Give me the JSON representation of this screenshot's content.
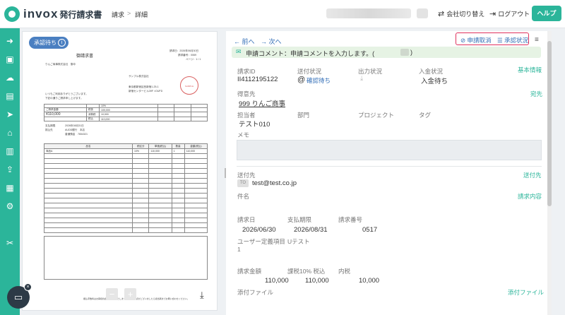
{
  "header": {
    "logo_text": "invox",
    "logo_sub": "発行請求書",
    "crumb_1": "請求",
    "crumb_sep": ">",
    "crumb_2": "詳細",
    "switch_company": "会社切り替え",
    "logout": "ログアウト",
    "help": "ヘルプ"
  },
  "document": {
    "status": "承認待ち",
    "title": "御請求書",
    "recipient": "りんご商事株式会社　御中",
    "issuer": "サンプル株式会社",
    "issuer_addr1": "東京都新宿区西新宿1-25-1",
    "issuer_addr2": "新宿センタービル39F ×OUFD",
    "date_label": "請求日：2026年06月30日",
    "number_label": "請求番号：0069",
    "page_label": "ページ：1 / 1",
    "greeting1": "いつもご利用ありがとうございます。",
    "greeting2": "下記の通りご請求申し上げます。",
    "stamp": "SAMPLE",
    "amount_label": "ご請求金額",
    "amount": "¥110,000",
    "tax_rate": "10%",
    "subtotal": "100,000",
    "tax": "10,000",
    "total": "110,000",
    "row_subtotal": "税抜",
    "row_tax": "消費税",
    "row_total": "税込",
    "due_label": "支払期限",
    "due_value": "2026年08月31日",
    "bank_label": "振込先",
    "bank_value": "AUDD銀行　本店",
    "account_value": "普通預金　7654321",
    "item_headers": [
      "品名",
      "税区分",
      "単価(税込)",
      "数量",
      "金額(税込)"
    ],
    "item_row": [
      "商品A",
      "10%",
      "110,000",
      "1",
      "110,000"
    ],
    "footer": "振込手数料はお客様負担でお願いいたします。ご不明な点がございましたら担当者までお問い合わせください。"
  },
  "detail": {
    "prev": "← 前へ",
    "next": "→ 次へ",
    "cancel_request": "申請取消",
    "approval_status": "承認状況",
    "comment": "申請コメント：申請コメントを入力します。(",
    "invoice_id_label": "請求ID",
    "invoice_id": "II4112195122",
    "send_status_label": "送付状況",
    "send_status": "確認待ち",
    "output_status_label": "出力状況",
    "payment_status_label": "入金状況",
    "payment_status": "入金待ち",
    "basic_info_link": "基本情報",
    "client_label": "得意先",
    "client": "999 りんご商事",
    "recipient_link": "宛先",
    "person_label": "担当者",
    "person": "テスト010",
    "dept_label": "部門",
    "project_label": "プロジェクト",
    "tag_label": "タグ",
    "memo_label": "メモ",
    "sendto_label": "送付先",
    "sendto_link": "送付先",
    "to_badge": "TO",
    "email": "test@test.co.jp",
    "subject_label": "件名",
    "content_link": "請求内容",
    "date_label": "請求日",
    "date": "2026/06/30",
    "due_label": "支払期限",
    "due": "2026/08/31",
    "number_label": "請求番号",
    "number": "0517",
    "custom_label": "ユーザー定義項目",
    "custom_num": "1",
    "custom_value": "Uテスト",
    "amount_label": "請求金額",
    "amount": "110,000",
    "tax_label": "課税10% 税込",
    "tax_amount": "110,000",
    "inner_tax_label": "内税",
    "inner_tax": "10,000",
    "attach_label": "添付ファイル",
    "attach_link": "添付ファイル"
  },
  "colors": {
    "brand": "#2bb59a",
    "link": "#2e6bb5",
    "highlight": "#e0315d",
    "status_pill": "#4a7fc1"
  }
}
